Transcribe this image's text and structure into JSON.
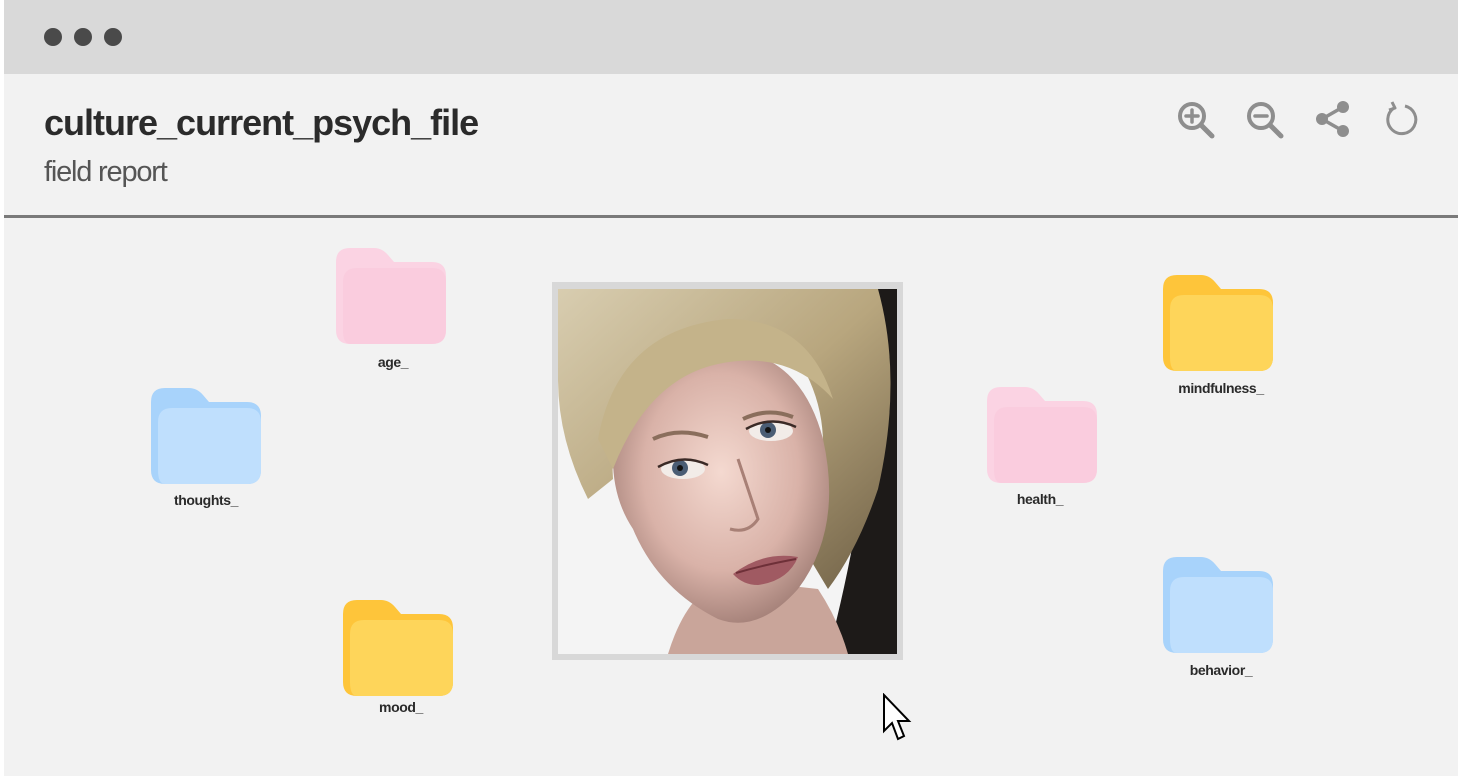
{
  "window": {
    "title": "culture_current_psych_file",
    "subtitle": "field report"
  },
  "toolbar": {
    "zoom_in_icon": "zoom-in-icon",
    "zoom_out_icon": "zoom-out-icon",
    "share_icon": "share-icon",
    "refresh_icon": "refresh-icon"
  },
  "folders": [
    {
      "label": "age_",
      "color": "#fbd3e3"
    },
    {
      "label": "thoughts_",
      "color": "#b9dcfb"
    },
    {
      "label": "mood_",
      "color": "#fed55a"
    },
    {
      "label": "health_",
      "color": "#fbd3e3"
    },
    {
      "label": "mindfulness_",
      "color": "#fed55a"
    },
    {
      "label": "behavior_",
      "color": "#b9dcfb"
    }
  ],
  "photo": {
    "subject": "portrait-photo"
  },
  "colors": {
    "window_bg": "#f2f2f2",
    "titlebar": "#d9d9d9",
    "icon_gray": "#8e8e8e",
    "pink_folder": "#fbd3e3",
    "blue_folder": "#b9dcfb",
    "yellow_folder": "#fed55a"
  }
}
